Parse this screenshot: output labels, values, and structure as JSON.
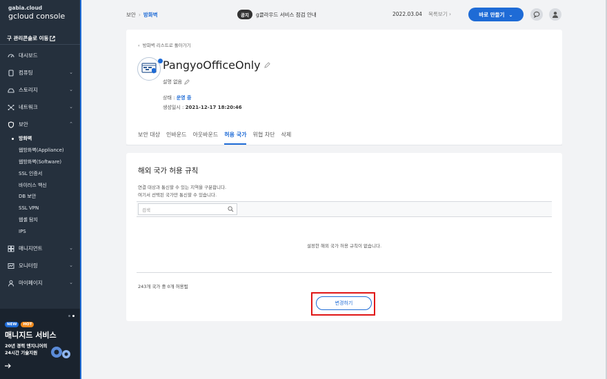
{
  "brand": {
    "logo_top": "gabia.cloud",
    "logo_main": "gcloud console"
  },
  "sidebar": {
    "legacy_link": "구 관리콘솔로 이동",
    "items": [
      {
        "label": "대시보드",
        "icon": "dashboard-icon",
        "chevron": false
      },
      {
        "label": "컴퓨팅",
        "icon": "server-icon",
        "chevron": true
      },
      {
        "label": "스토리지",
        "icon": "storage-icon",
        "chevron": true
      },
      {
        "label": "네트워크",
        "icon": "network-icon",
        "chevron": true
      },
      {
        "label": "보안",
        "icon": "shield-icon",
        "chevron": true,
        "expanded": true
      }
    ],
    "security_sub": [
      "방화벽",
      "웹방화벽(Appliance)",
      "웹방화벽(Software)",
      "SSL 인증서",
      "바이러스 백신",
      "DB 보안",
      "SSL VPN",
      "웹셸 탐지",
      "IPS"
    ],
    "bottom_items": [
      {
        "label": "매니지먼트",
        "icon": "management-icon"
      },
      {
        "label": "모니터링",
        "icon": "monitoring-icon"
      },
      {
        "label": "마이페이지",
        "icon": "user-icon"
      }
    ],
    "promo": {
      "badge_new": "NEW",
      "badge_hot": "HOT",
      "title": "매니지드 서비스",
      "sub1": "20년 경력 엔지니어의",
      "sub2": "24시간 기술지원"
    }
  },
  "header": {
    "breadcrumb_root": "보안",
    "breadcrumb_current": "방화벽",
    "notice_tag": "공지",
    "notice_text": "g클라우드 서비스 점검 안내",
    "date": "2022.03.04",
    "list_view": "목록보기",
    "create_button": "바로 만들기"
  },
  "firewall": {
    "back_link": "방화벽 리스트로 돌아가기",
    "name": "PangyoOfficeOnly",
    "description": "설명 없음",
    "state_label": "상태 : ",
    "state_value": "운영 중",
    "created_label": "생성일시 : ",
    "created_value": "2021-12-17 18:20:46"
  },
  "tabs": [
    "보안 대상",
    "인바운드",
    "아웃바운드",
    "허용 국가",
    "위협 차단",
    "삭제"
  ],
  "active_tab": 3,
  "content": {
    "title": "해외 국가 허용 규칙",
    "desc1": "연결 대상과 통신할 수 있는 지역을 구분합니다.",
    "desc2": "여기서 선택된 국가만 통신할 수 있습니다.",
    "search_placeholder": "검색",
    "empty_message": "설정한 해외 국가 허용 규칙이 없습니다.",
    "count_text": "243개 국가 중 0개 허용됨",
    "change_button": "변경하기"
  },
  "colors": {
    "accent": "#1e6bd6",
    "sidebar": "#25303d",
    "highlight": "#e01515"
  }
}
